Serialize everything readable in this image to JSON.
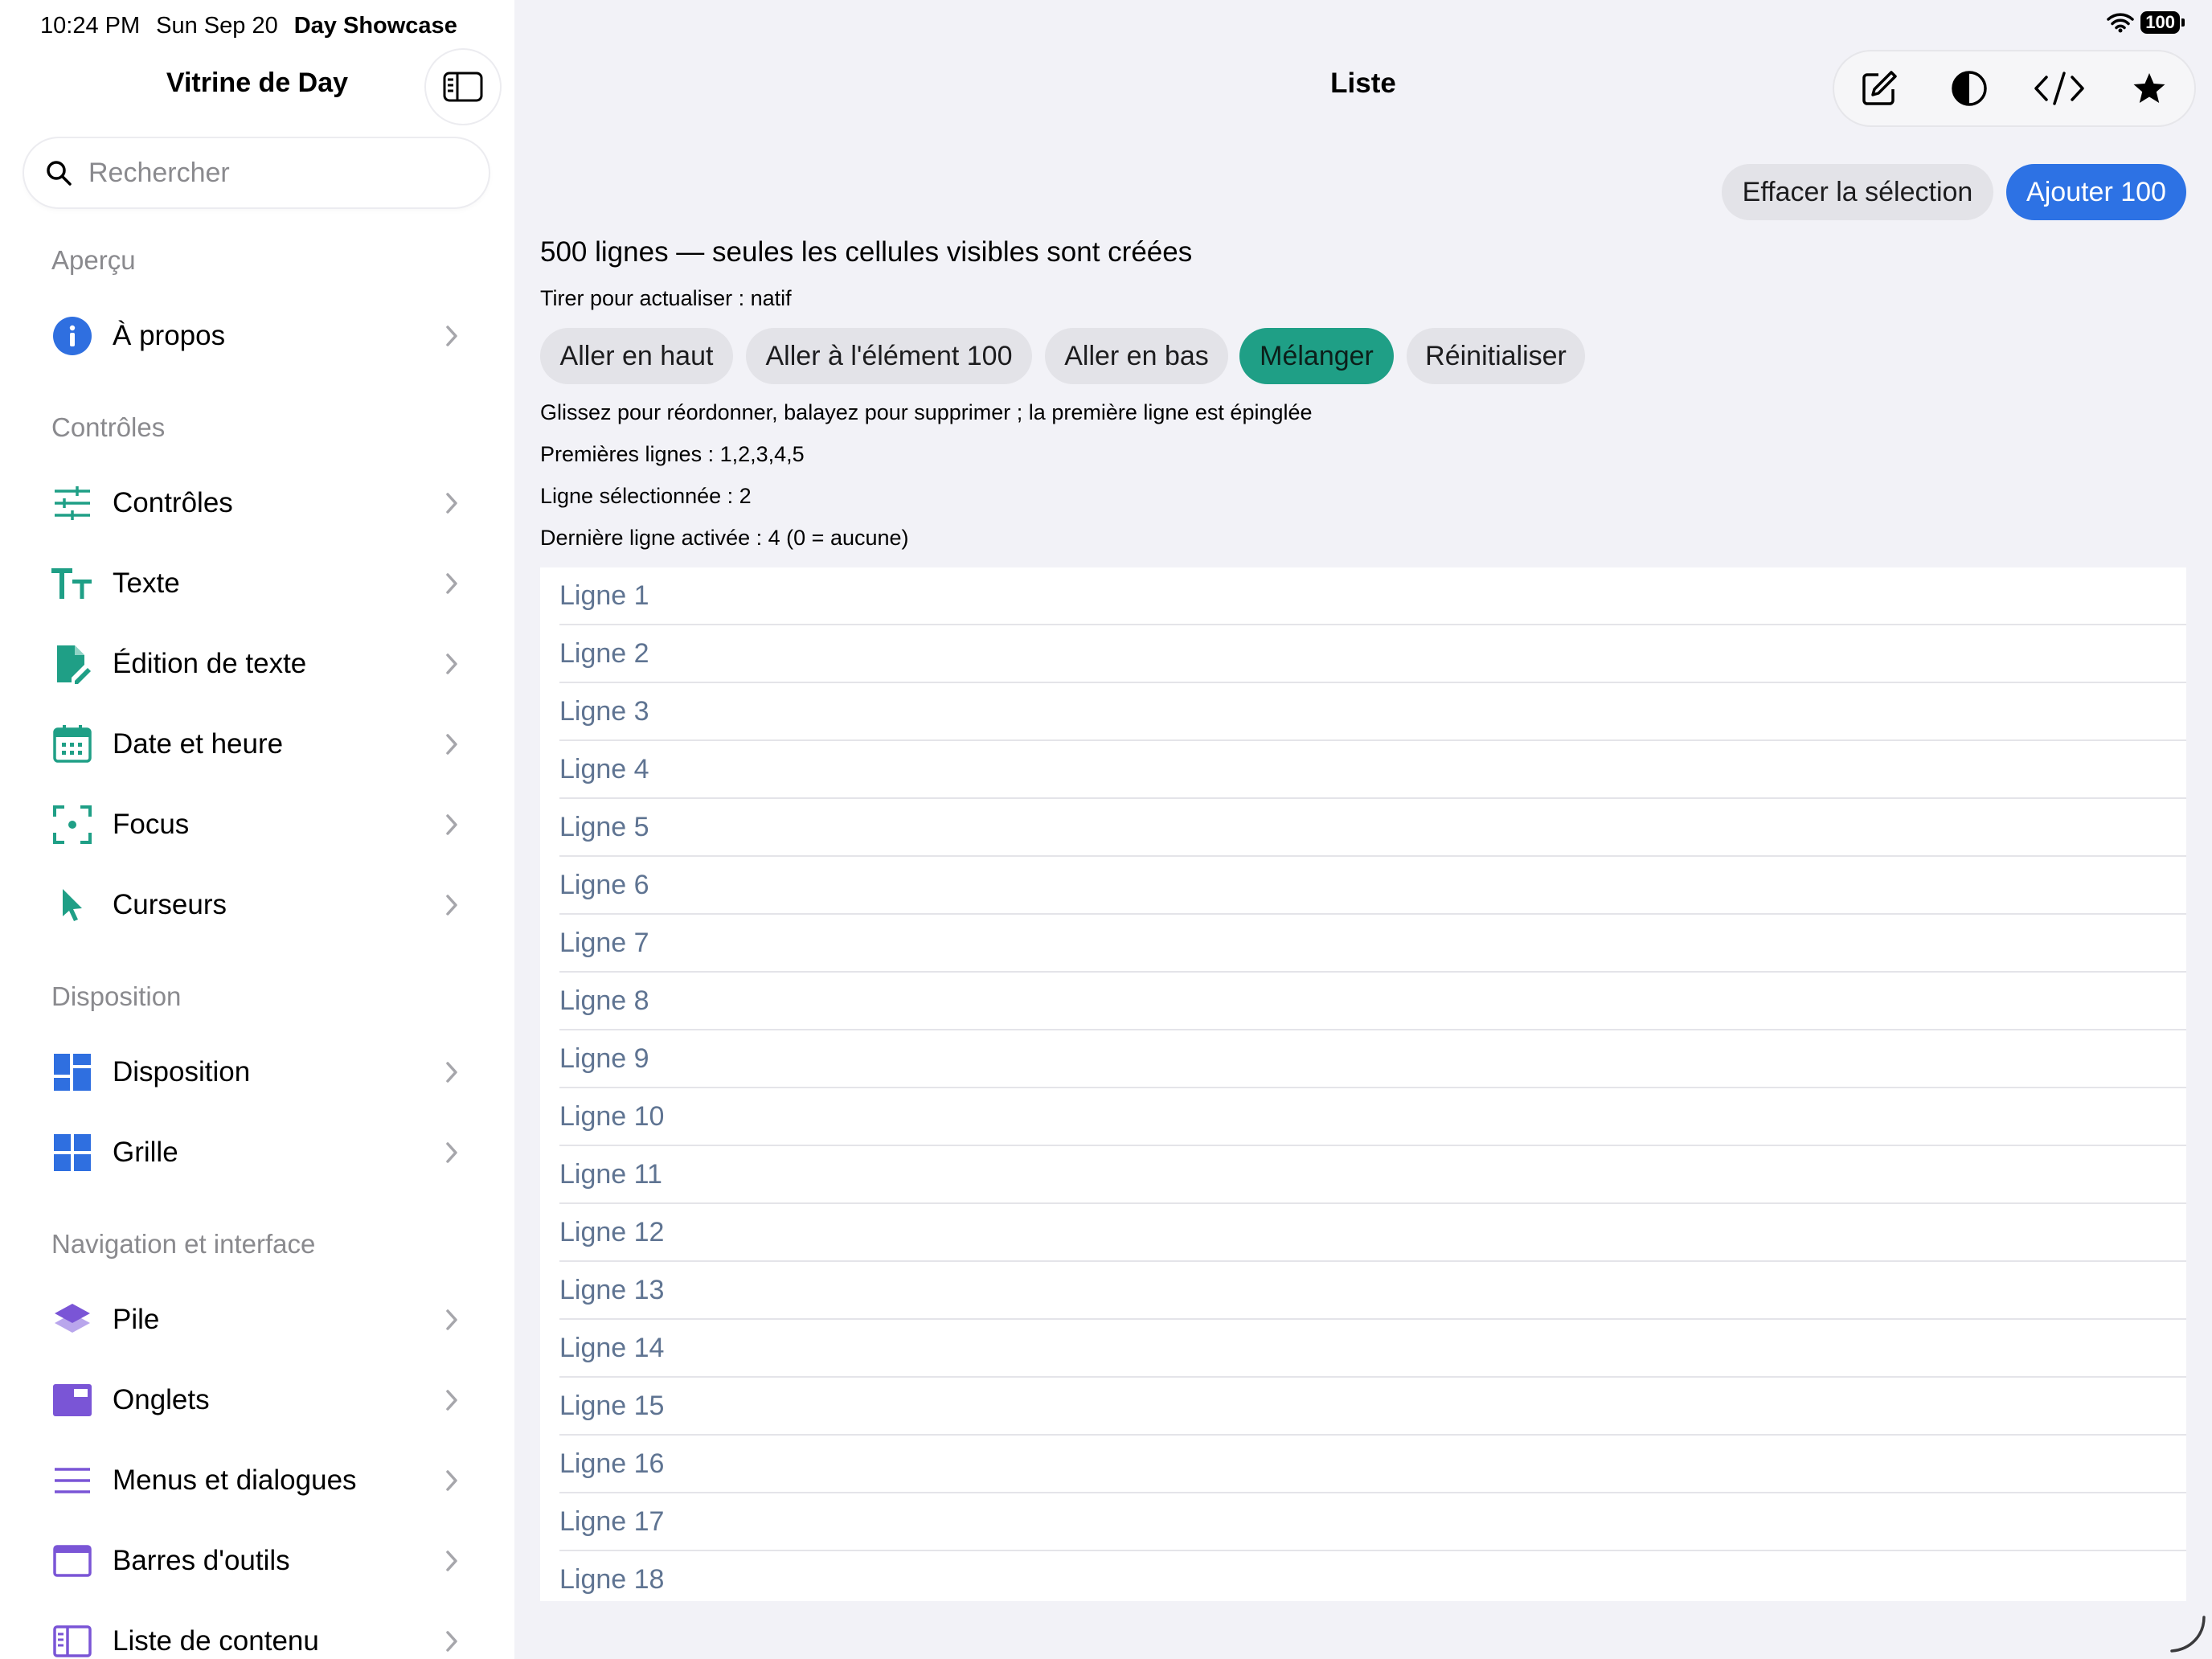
{
  "status": {
    "time": "10:24 PM",
    "date": "Sun Sep 20",
    "app": "Day Showcase",
    "battery": "100"
  },
  "sidebar": {
    "title": "Vitrine de Day",
    "search_placeholder": "Rechercher",
    "sections": [
      {
        "header": "Aperçu",
        "items": [
          {
            "label": "À propos",
            "icon": "info-circle-icon",
            "color": "#2f6fe0"
          }
        ]
      },
      {
        "header": "Contrôles",
        "items": [
          {
            "label": "Contrôles",
            "icon": "sliders-icon",
            "color": "#1f9f86"
          },
          {
            "label": "Texte",
            "icon": "text-size-icon",
            "color": "#1f9f86"
          },
          {
            "label": "Édition de texte",
            "icon": "doc-edit-icon",
            "color": "#1f9f86"
          },
          {
            "label": "Date et heure",
            "icon": "calendar-icon",
            "color": "#1f9f86"
          },
          {
            "label": "Focus",
            "icon": "viewfinder-icon",
            "color": "#1f9f86"
          },
          {
            "label": "Curseurs",
            "icon": "pointer-icon",
            "color": "#1f9f86"
          }
        ]
      },
      {
        "header": "Disposition",
        "items": [
          {
            "label": "Disposition",
            "icon": "layout-icon",
            "color": "#2f6fe0"
          },
          {
            "label": "Grille",
            "icon": "grid-icon",
            "color": "#2f6fe0"
          }
        ]
      },
      {
        "header": "Navigation et interface",
        "items": [
          {
            "label": "Pile",
            "icon": "stack-icon",
            "color": "#7a55d6"
          },
          {
            "label": "Onglets",
            "icon": "tabs-icon",
            "color": "#7a55d6"
          },
          {
            "label": "Menus et dialogues",
            "icon": "menu-lines-icon",
            "color": "#7a55d6"
          },
          {
            "label": "Barres d'outils",
            "icon": "toolbar-window-icon",
            "color": "#7a55d6"
          },
          {
            "label": "Liste de contenu",
            "icon": "sidebar-list-icon",
            "color": "#7a55d6"
          }
        ]
      }
    ]
  },
  "main": {
    "title": "Liste",
    "toolbar_icons": [
      "compose-icon",
      "contrast-icon",
      "code-icon",
      "star-icon"
    ],
    "clear_selection": "Effacer la sélection",
    "add_100": "Ajouter 100",
    "heading": "500 lignes — seules les cellules visibles sont créées",
    "pull_refresh": "Tirer pour actualiser : natif",
    "actions": [
      "Aller en haut",
      "Aller à l'élément 100",
      "Aller en bas",
      "Mélanger",
      "Réinitialiser"
    ],
    "active_action": "Mélanger",
    "hint": "Glissez pour réordonner, balayez pour supprimer ; la première ligne est épinglée",
    "first_rows": "Premières lignes : 1,2,3,4,5",
    "selected_row": "Ligne sélectionnée : 2",
    "last_activated": "Dernière ligne activée : 4 (0 = aucune)",
    "rows": [
      "Ligne 1",
      "Ligne 2",
      "Ligne 3",
      "Ligne 4",
      "Ligne 5",
      "Ligne 6",
      "Ligne 7",
      "Ligne 8",
      "Ligne 9",
      "Ligne 10",
      "Ligne 11",
      "Ligne 12",
      "Ligne 13",
      "Ligne 14",
      "Ligne 15",
      "Ligne 16",
      "Ligne 17",
      "Ligne 18"
    ]
  }
}
